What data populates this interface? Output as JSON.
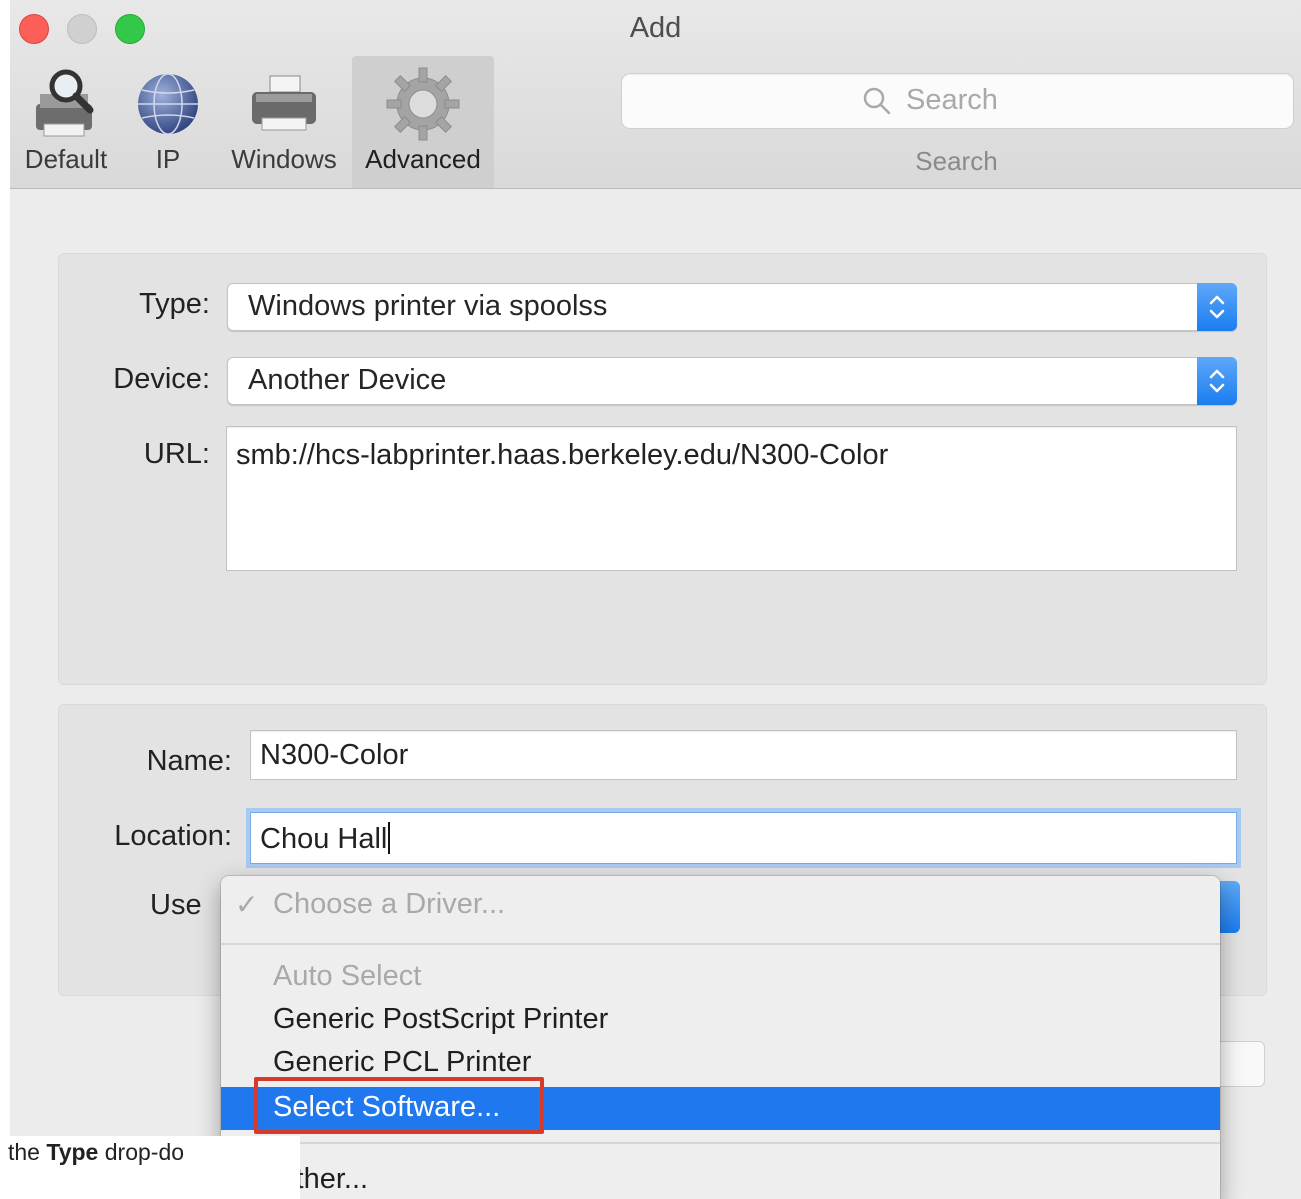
{
  "window": {
    "title": "Add"
  },
  "toolbar": {
    "items": [
      {
        "label": "Default",
        "icon": "printer-magnifier-icon"
      },
      {
        "label": "IP",
        "icon": "globe-icon"
      },
      {
        "label": "Windows",
        "icon": "printer-icon"
      },
      {
        "label": "Advanced",
        "icon": "gear-icon",
        "selected": true
      }
    ],
    "search": {
      "placeholder": "Search",
      "caption": "Search"
    }
  },
  "connection": {
    "type_label": "Type:",
    "type_value": "Windows printer via spoolss",
    "device_label": "Device:",
    "device_value": "Another Device",
    "url_label": "URL:",
    "url_value": "smb://hcs-labprinter.haas.berkeley.edu/N300-Color"
  },
  "printer": {
    "name_label": "Name:",
    "name_value": "N300-Color",
    "location_label": "Location:",
    "location_value": "Chou Hall",
    "use_label": "Use"
  },
  "driver_menu": {
    "checked": "Choose a Driver...",
    "items": [
      {
        "label": "Auto Select",
        "disabled": true
      },
      {
        "label": "Generic PostScript Printer"
      },
      {
        "label": "Generic PCL Printer"
      },
      {
        "label": "Select Software...",
        "highlighted": true
      },
      {
        "label": "Other..."
      }
    ]
  },
  "background_doc": {
    "prefix": "the ",
    "bold": "Type",
    "suffix": " drop-do"
  },
  "colors": {
    "accent": "#1f78ee",
    "callout": "#d63a2b"
  }
}
